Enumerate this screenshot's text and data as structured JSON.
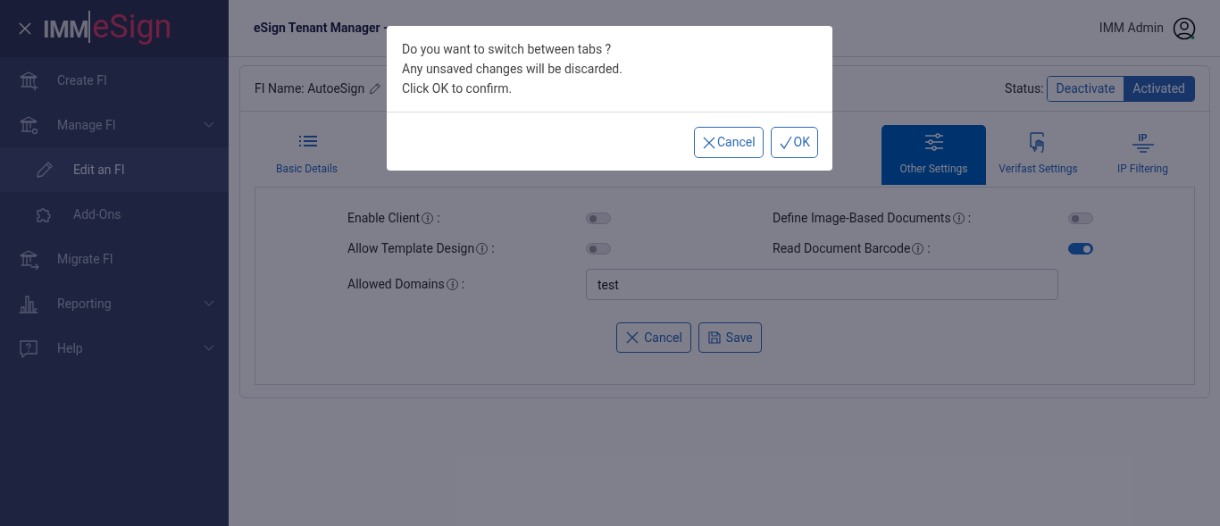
{
  "sidebar": {
    "brand": {
      "left": "IMM",
      "right": "eSign"
    },
    "items": [
      {
        "kind": "item",
        "label": "Create FI",
        "selected": false
      },
      {
        "kind": "group",
        "label": "Manage FI",
        "selected": false
      },
      {
        "kind": "sub",
        "label": "Edit an FI",
        "selected": true
      },
      {
        "kind": "sub",
        "label": "Add-Ons",
        "selected": false
      },
      {
        "kind": "item",
        "label": "Migrate FI",
        "selected": false
      },
      {
        "kind": "group",
        "label": "Reporting",
        "selected": false
      },
      {
        "kind": "group",
        "label": "Help",
        "selected": false
      }
    ]
  },
  "header": {
    "title": "eSign Tenant Manager -",
    "user": "IMM Admin"
  },
  "card": {
    "fi_name": "FI Name: AutoeSign",
    "status_label": "Status:",
    "status_options": [
      {
        "label": "Deactivate",
        "selected": false
      },
      {
        "label": "Activated",
        "selected": true
      }
    ],
    "tabs": [
      {
        "label": "Basic Details",
        "selected": false
      },
      {
        "label": "Other Settings",
        "selected": true
      },
      {
        "label": "Verifast Settings",
        "selected": false
      },
      {
        "label": "IP Filtering",
        "icon_text": "IP",
        "selected": false
      }
    ],
    "settings": [
      {
        "label": "Enable Client",
        "colon": ":",
        "on": false
      },
      {
        "label": "Define Image-Based Documents",
        "colon": ":",
        "on": false
      },
      {
        "label": "Allow Template Design",
        "colon": ":",
        "on": false
      },
      {
        "label": "Read Document Barcode",
        "colon": ":",
        "on": true
      }
    ],
    "domains": {
      "label": "Allowed Domains",
      "colon": ":",
      "value": "test"
    },
    "buttons": [
      {
        "kind": "cancel",
        "label": "Cancel"
      },
      {
        "kind": "save",
        "label": "Save"
      }
    ]
  },
  "dialog": {
    "lines": [
      "Do you want to switch between tabs ?",
      "Any unsaved changes will be discarded.",
      "Click OK to confirm."
    ],
    "buttons": [
      {
        "kind": "cancel",
        "label": "Cancel"
      },
      {
        "kind": "ok",
        "label": "OK"
      }
    ]
  }
}
